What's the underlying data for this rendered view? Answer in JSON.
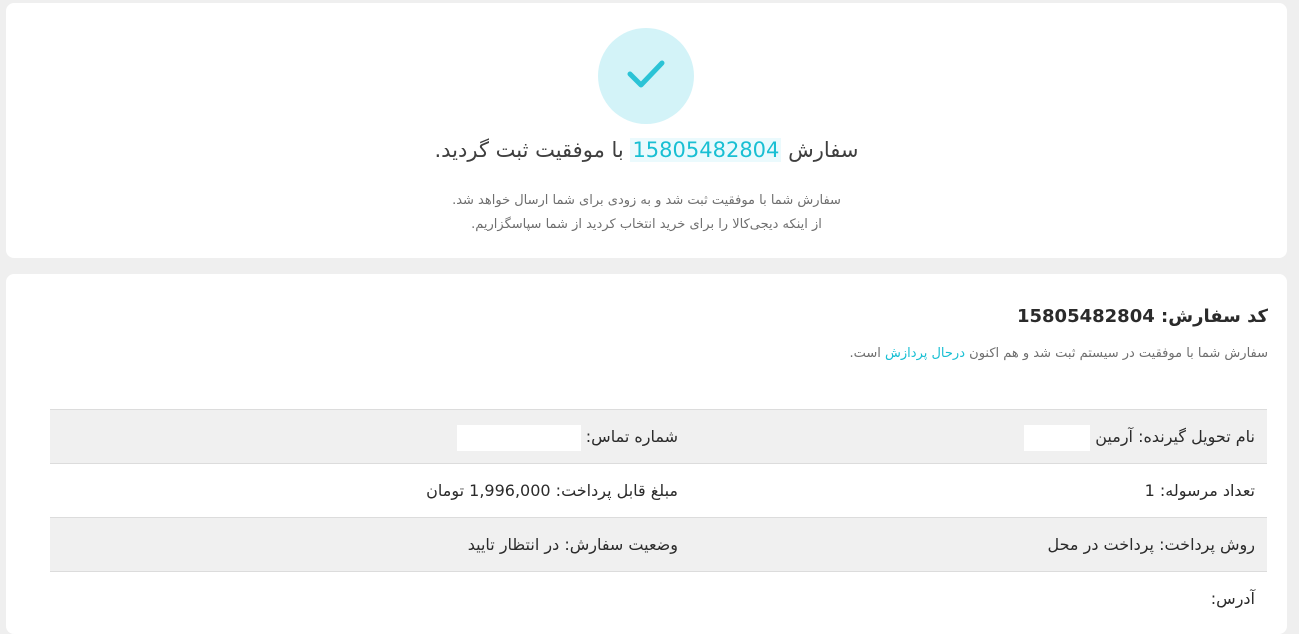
{
  "success": {
    "title_before": "سفارش",
    "order_number": "15805482804",
    "title_after": "با موفقیت ثبت گردید.",
    "message_line1": "سفارش شما با موفقیت ثبت شد و به زودی برای شما ارسال خواهد شد.",
    "message_line2": "از اینکه دیجی‌کالا را برای خرید انتخاب کردید از شما سپاسگزاریم."
  },
  "details": {
    "code_label": "کد سفارش:",
    "code_value": "15805482804",
    "status_before": "سفارش شما با موفقیت در سیستم ثبت شد و هم اکنون",
    "status_highlight": "درحال پردازش",
    "status_after": "است.",
    "rows": [
      {
        "right": {
          "label": "نام تحویل گیرنده:",
          "value": "آرمین"
        },
        "left": {
          "label": "شماره تماس:",
          "value": ""
        }
      },
      {
        "right": {
          "label": "تعداد مرسوله:",
          "value": "1"
        },
        "left": {
          "label": "مبلغ قابل پرداخت:",
          "value": "1,996,000 تومان"
        }
      },
      {
        "right": {
          "label": "روش پرداخت:",
          "value": "پرداخت در محل"
        },
        "left": {
          "label": "وضعیت سفارش:",
          "value": "در انتظار تایید"
        }
      },
      {
        "right": {
          "label": "آدرس:",
          "value": ""
        }
      }
    ]
  },
  "colors": {
    "accent": "#19bfd3",
    "check_bg": "#d3f3f8"
  },
  "icons": {
    "success": "check-icon"
  }
}
